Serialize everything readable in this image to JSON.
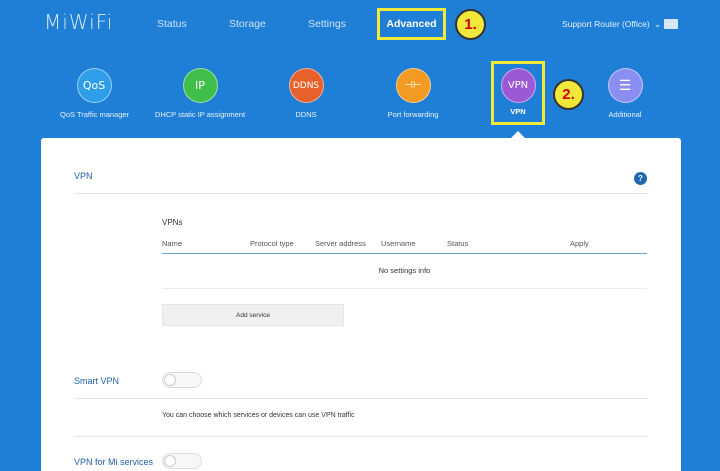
{
  "header": {
    "logo": "MiWiFi",
    "nav": [
      "Status",
      "Storage",
      "Settings",
      "Advanced"
    ],
    "router_name": "Support Router (Office)",
    "router_chevron_icon": "chevron-down-icon",
    "mail_icon": "mail-icon"
  },
  "steps": [
    "1.",
    "2."
  ],
  "features": [
    {
      "icon_text": "QoS",
      "label": "QoS Traffic manager",
      "color": "#2f9ee8"
    },
    {
      "icon_text": "IP",
      "label": "DHCP static IP assignment",
      "color": "#3fbf4a"
    },
    {
      "icon_text": "DDNS",
      "label": "DDNS",
      "color": "#e8612c"
    },
    {
      "icon_text": "⊣⊢",
      "label": "Port forwarding",
      "color": "#f39a22"
    },
    {
      "icon_text": "VPN",
      "label": "VPN",
      "color": "#9b59d6"
    },
    {
      "icon_text": "☰",
      "label": "Additional",
      "color": "#8a8ef0"
    }
  ],
  "vpn_section": {
    "title": "VPN",
    "help": "?",
    "list_title": "VPNs",
    "columns": [
      "Name",
      "Protocol type",
      "Server address",
      "Username",
      "Status",
      "Apply"
    ],
    "empty_text": "No settings info",
    "add_button": "Add service"
  },
  "smart_vpn": {
    "title": "Smart VPN",
    "enabled": false,
    "description": "You can choose which services or devices can use VPN traffic"
  },
  "mi_services": {
    "title": "VPN for Mi services",
    "enabled": false
  }
}
